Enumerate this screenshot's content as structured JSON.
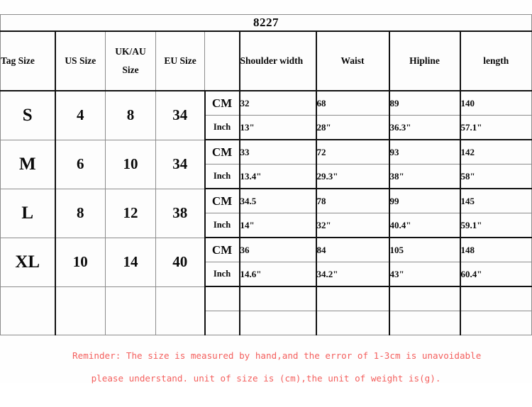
{
  "title": "8227",
  "columns": {
    "tag_size": "Tag Size",
    "us_size": "US Size",
    "uk_au_size": "UK/AU Size",
    "eu_size": "EU Size",
    "unit": "",
    "shoulder_width": "Shoulder width",
    "waist": "Waist",
    "hipline": "Hipline",
    "length": "length"
  },
  "units": {
    "cm": "CM",
    "inch": "Inch"
  },
  "rows": [
    {
      "tag_size": "S",
      "us_size": "4",
      "uk_au_size": "8",
      "eu_size": "34",
      "cm": {
        "shoulder_width": "32",
        "waist": "68",
        "hipline": "89",
        "length": "140"
      },
      "inch": {
        "shoulder_width": "13\"",
        "waist": "28\"",
        "hipline": "36.3\"",
        "length": "57.1\""
      }
    },
    {
      "tag_size": "M",
      "us_size": "6",
      "uk_au_size": "10",
      "eu_size": "34",
      "cm": {
        "shoulder_width": "33",
        "waist": "72",
        "hipline": "93",
        "length": "142"
      },
      "inch": {
        "shoulder_width": "13.4\"",
        "waist": "29.3\"",
        "hipline": "38\"",
        "length": "58\""
      }
    },
    {
      "tag_size": "L",
      "us_size": "8",
      "uk_au_size": "12",
      "eu_size": "38",
      "cm": {
        "shoulder_width": "34.5",
        "waist": "78",
        "hipline": "99",
        "length": "145"
      },
      "inch": {
        "shoulder_width": "14\"",
        "waist": "32\"",
        "hipline": "40.4\"",
        "length": "59.1\""
      }
    },
    {
      "tag_size": "XL",
      "us_size": "10",
      "uk_au_size": "14",
      "eu_size": "40",
      "cm": {
        "shoulder_width": "36",
        "waist": "84",
        "hipline": "105",
        "length": "148"
      },
      "inch": {
        "shoulder_width": "14.6\"",
        "waist": "34.2\"",
        "hipline": "43\"",
        "length": "60.4\""
      }
    },
    {
      "tag_size": "",
      "us_size": "",
      "uk_au_size": "",
      "eu_size": "",
      "cm": {
        "shoulder_width": "",
        "waist": "",
        "hipline": "",
        "length": ""
      },
      "inch": {
        "shoulder_width": "",
        "waist": "",
        "hipline": "",
        "length": ""
      }
    }
  ],
  "reminder": {
    "line1": "Reminder: The size is measured by hand,and the error of 1-3cm is unavoidable",
    "line2": "please understand. unit of size is (cm),the unit of weight is(g).",
    "color": "#f4605e"
  },
  "colors": {
    "text": "#0a0a0a",
    "grid_light": "#8c8c8c",
    "grid_heavy": "#111111",
    "background": "#fefefe"
  }
}
